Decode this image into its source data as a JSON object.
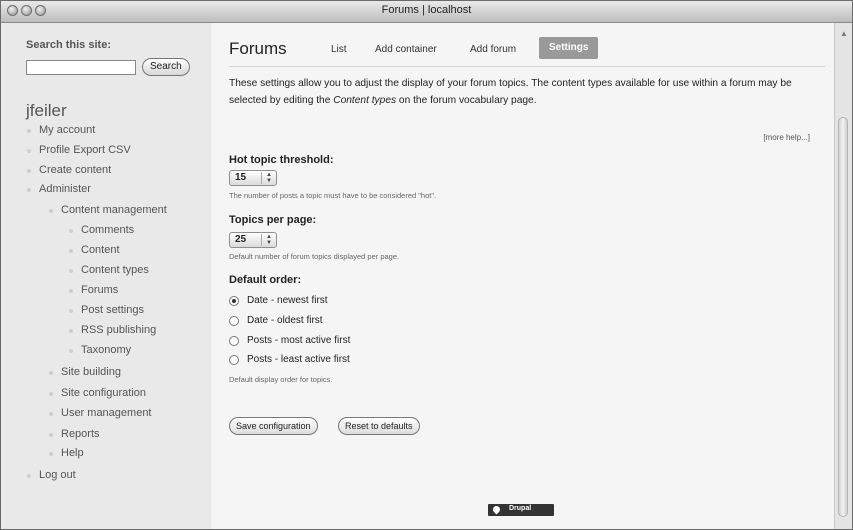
{
  "window": {
    "title": "Forums | localhost"
  },
  "sidebar": {
    "search_title": "Search this site:",
    "search_value": "",
    "search_button": "Search",
    "username": "jfeiler",
    "nav": [
      {
        "label": "My account"
      },
      {
        "label": "Profile Export CSV"
      },
      {
        "label": "Create content"
      },
      {
        "label": "Administer"
      },
      {
        "label": "Content management"
      },
      {
        "label": "Comments"
      },
      {
        "label": "Content"
      },
      {
        "label": "Content types"
      },
      {
        "label": "Forums"
      },
      {
        "label": "Post settings"
      },
      {
        "label": "RSS publishing"
      },
      {
        "label": "Taxonomy"
      },
      {
        "label": "Site building"
      },
      {
        "label": "Site configuration"
      },
      {
        "label": "User management"
      },
      {
        "label": "Reports"
      },
      {
        "label": "Help"
      },
      {
        "label": "Log out"
      }
    ]
  },
  "main": {
    "title": "Forums",
    "tabs": [
      {
        "label": "List"
      },
      {
        "label": "Add container"
      },
      {
        "label": "Add forum"
      },
      {
        "label": "Settings"
      }
    ],
    "intro_part1": "These settings allow you to adjust the display of your forum topics. The content types available for use within a forum may be selected by editing the ",
    "intro_emph": "Content types",
    "intro_part2": " on the forum vocabulary page.",
    "more_help": "[more help...]",
    "hot_topic": {
      "label": "Hot topic threshold:",
      "value": "15",
      "help": "The number of posts a topic must have to be considered \"hot\"."
    },
    "topics_per_page": {
      "label": "Topics per page:",
      "value": "25",
      "help": "Default number of forum topics displayed per page."
    },
    "default_order": {
      "label": "Default order:",
      "options": [
        {
          "label": "Date - newest first",
          "checked": true
        },
        {
          "label": "Date - oldest first",
          "checked": false
        },
        {
          "label": "Posts - most active first",
          "checked": false
        },
        {
          "label": "Posts - least active first",
          "checked": false
        }
      ],
      "help": "Default display order for topics."
    },
    "buttons": {
      "save": "Save configuration",
      "reset": "Reset to defaults"
    },
    "footer_badge": "Drupal"
  }
}
